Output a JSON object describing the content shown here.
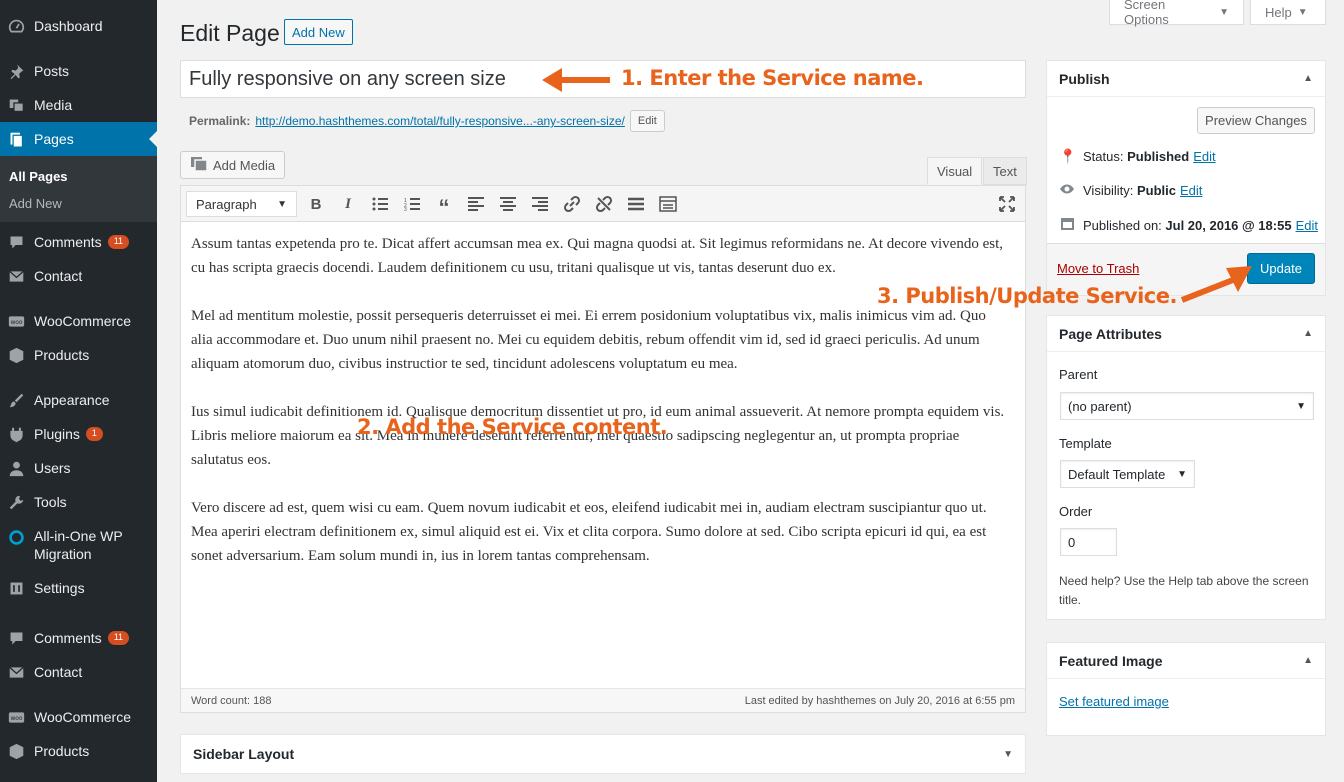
{
  "sidebar": {
    "items": [
      {
        "label": "Dashboard",
        "icon": "dashboard-icon"
      },
      {
        "label": "Posts",
        "icon": "pin-icon"
      },
      {
        "label": "Media",
        "icon": "media-icon"
      },
      {
        "label": "Pages",
        "icon": "pages-icon"
      },
      {
        "label": "Comments",
        "icon": "comments-icon",
        "badge": "11"
      },
      {
        "label": "Contact",
        "icon": "mail-icon"
      },
      {
        "label": "WooCommerce",
        "icon": "woo-icon"
      },
      {
        "label": "Products",
        "icon": "products-icon"
      },
      {
        "label": "Appearance",
        "icon": "brush-icon"
      },
      {
        "label": "Plugins",
        "icon": "plugin-icon",
        "badge": "1"
      },
      {
        "label": "Users",
        "icon": "users-icon"
      },
      {
        "label": "Tools",
        "icon": "wrench-icon"
      },
      {
        "label": "All-in-One WP Migration",
        "icon": "migration-icon"
      },
      {
        "label": "Settings",
        "icon": "settings-icon"
      },
      {
        "label": "Comments",
        "icon": "comments-icon",
        "badge": "11"
      },
      {
        "label": "Contact",
        "icon": "mail-icon"
      },
      {
        "label": "WooCommerce",
        "icon": "woo-icon"
      },
      {
        "label": "Products",
        "icon": "products-icon"
      }
    ],
    "sub": {
      "all_pages": "All Pages",
      "add_new": "Add New"
    }
  },
  "top": {
    "screen_options": "Screen Options",
    "help": "Help"
  },
  "page": {
    "heading": "Edit Page",
    "add_new": "Add New",
    "title_value": "Fully responsive on any screen size",
    "permalink_label": "Permalink:",
    "permalink_url": "http://demo.hashthemes.com/total/fully-responsive...-any-screen-size/",
    "permalink_edit": "Edit"
  },
  "annotations": {
    "a1": "1. Enter the Service name.",
    "a2": "2. Add the Service content.",
    "a3": "3. Publish/Update Service."
  },
  "editor": {
    "add_media": "Add Media",
    "tab_visual": "Visual",
    "tab_text": "Text",
    "format": "Paragraph",
    "paragraphs": [
      "Assum tantas expetenda pro te. Dicat affert accumsan mea ex. Qui magna quodsi at. Sit legimus reformidans ne. At decore vivendo est, cu has scripta graecis docendi. Laudem definitionem cu usu, tritani qualisque ut vis, tantas deserunt duo ex.",
      "Mel ad mentitum molestie, possit persequeris deterruisset ei mei. Ei errem posidonium voluptatibus vix, malis inimicus vim ad. Quo alia accommodare et. Duo unum nihil praesent no. Mei cu equidem debitis, rebum offendit vim id, sed id graeci periculis. Ad unum aliquam atomorum duo, civibus instructior te sed, tincidunt adolescens voluptatum eu mea.",
      "Ius simul iudicabit definitionem id. Qualisque democritum dissentiet ut pro, id eum animal assueverit. At nemore prompta equidem vis. Libris meliore maiorum ea sit. Mea in munere deserunt referrentur, mei quaestio sadipscing neglegentur an, ut prompta propriae salutatus eos.",
      "Vero discere ad est, quem wisi cu eam. Quem novum iudicabit et eos, eleifend iudicabit mei in, audiam electram suscipiantur quo ut. Mea aperiri electram definitionem ex, simul aliquid est ei. Vix et clita corpora. Sumo dolore at sed. Cibo scripta epicuri id qui, ea est sonet adversarium. Eam solum mundi in, ius in lorem tantas comprehensam."
    ],
    "word_count": "Word count: 188",
    "last_edited": "Last edited by hashthemes on July 20, 2016 at 6:55 pm"
  },
  "sidebar_layout": {
    "title": "Sidebar Layout"
  },
  "publish": {
    "title": "Publish",
    "preview": "Preview Changes",
    "status_label": "Status:",
    "status_value": "Published",
    "visibility_label": "Visibility:",
    "visibility_value": "Public",
    "published_label": "Published on:",
    "published_value": "Jul 20, 2016 @ 18:55",
    "edit": "Edit",
    "trash": "Move to Trash",
    "update": "Update"
  },
  "page_attributes": {
    "title": "Page Attributes",
    "parent_label": "Parent",
    "parent_value": "(no parent)",
    "template_label": "Template",
    "template_value": "Default Template",
    "order_label": "Order",
    "order_value": "0",
    "help": "Need help? Use the Help tab above the screen title."
  },
  "featured": {
    "title": "Featured Image",
    "link": "Set featured image"
  },
  "colors": {
    "accent": "#0073aa",
    "annotation": "#e8631c",
    "sidebar": "#23282d",
    "badge": "#d54e21"
  }
}
